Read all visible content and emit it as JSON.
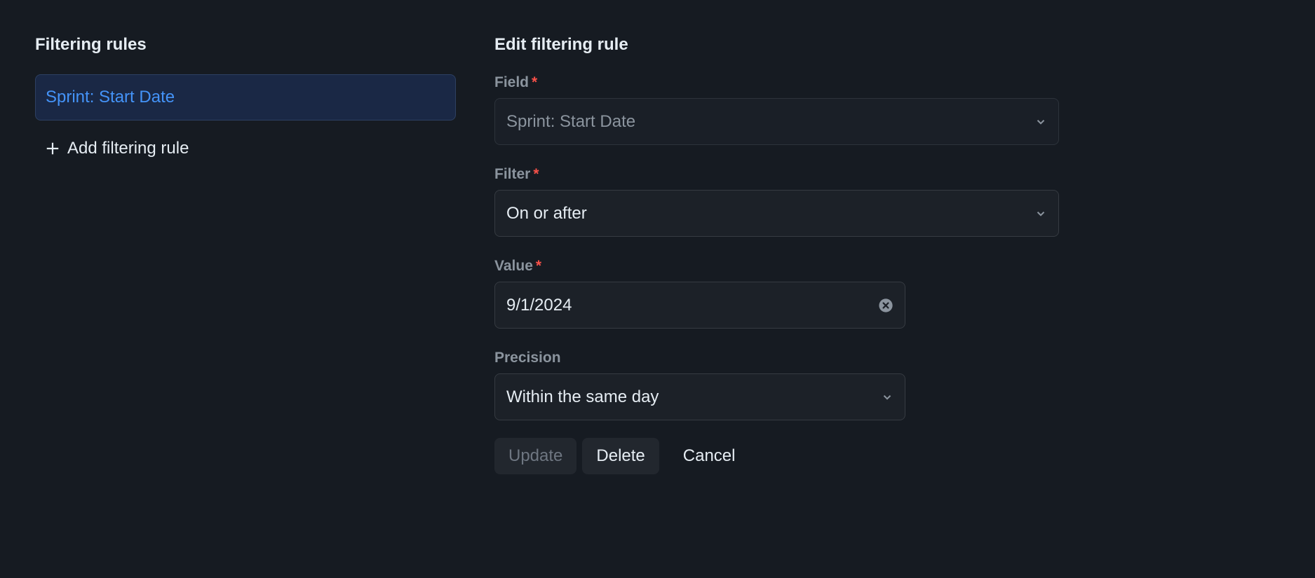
{
  "left": {
    "title": "Filtering rules",
    "rules": [
      {
        "label": "Sprint: Start Date"
      }
    ],
    "add_label": "Add filtering rule"
  },
  "right": {
    "title": "Edit filtering rule",
    "field": {
      "label": "Field",
      "value": "Sprint: Start Date"
    },
    "filter": {
      "label": "Filter",
      "value": "On or after"
    },
    "value": {
      "label": "Value",
      "value": "9/1/2024"
    },
    "precision": {
      "label": "Precision",
      "value": "Within the same day"
    },
    "actions": {
      "update": "Update",
      "delete": "Delete",
      "cancel": "Cancel"
    }
  }
}
